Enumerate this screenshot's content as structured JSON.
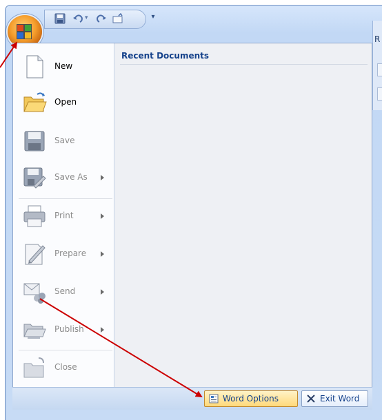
{
  "colors": {
    "accent": "#15428b",
    "arrow": "#cc0000",
    "highlight": "#ffd97a"
  },
  "ribbon": {
    "peek_label": "R"
  },
  "qat": {
    "icons": [
      "save-icon",
      "undo-icon",
      "redo-icon",
      "open-folder-icon"
    ],
    "dropdown_glyph": "▾"
  },
  "menu": {
    "items": [
      {
        "label": "New",
        "enabled": true,
        "submenu": false
      },
      {
        "label": "Open",
        "enabled": true,
        "submenu": false
      },
      {
        "label": "Save",
        "enabled": false,
        "submenu": false
      },
      {
        "label": "Save As",
        "enabled": false,
        "submenu": true
      },
      {
        "label": "Print",
        "enabled": false,
        "submenu": true
      },
      {
        "label": "Prepare",
        "enabled": false,
        "submenu": true
      },
      {
        "label": "Send",
        "enabled": false,
        "submenu": true
      },
      {
        "label": "Publish",
        "enabled": false,
        "submenu": true
      },
      {
        "label": "Close",
        "enabled": false,
        "submenu": false
      }
    ],
    "recent_title": "Recent Documents"
  },
  "footer": {
    "word_options": "Word Options",
    "exit_word": "Exit Word"
  }
}
